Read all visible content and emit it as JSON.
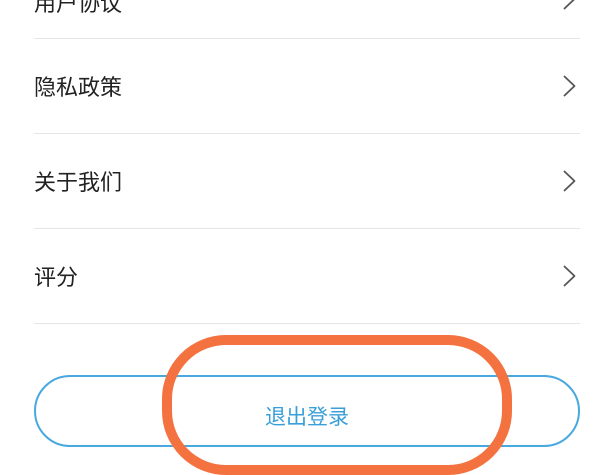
{
  "settings_list": {
    "items": [
      {
        "label": "用户协议"
      },
      {
        "label": "隐私政策"
      },
      {
        "label": "关于我们"
      },
      {
        "label": "评分"
      }
    ]
  },
  "logout": {
    "label": "退出登录"
  },
  "colors": {
    "accent": "#3a9fd8",
    "highlight": "#f4723f",
    "divider": "#e6e6e6"
  },
  "icons": [
    "chevron-right-icon"
  ]
}
